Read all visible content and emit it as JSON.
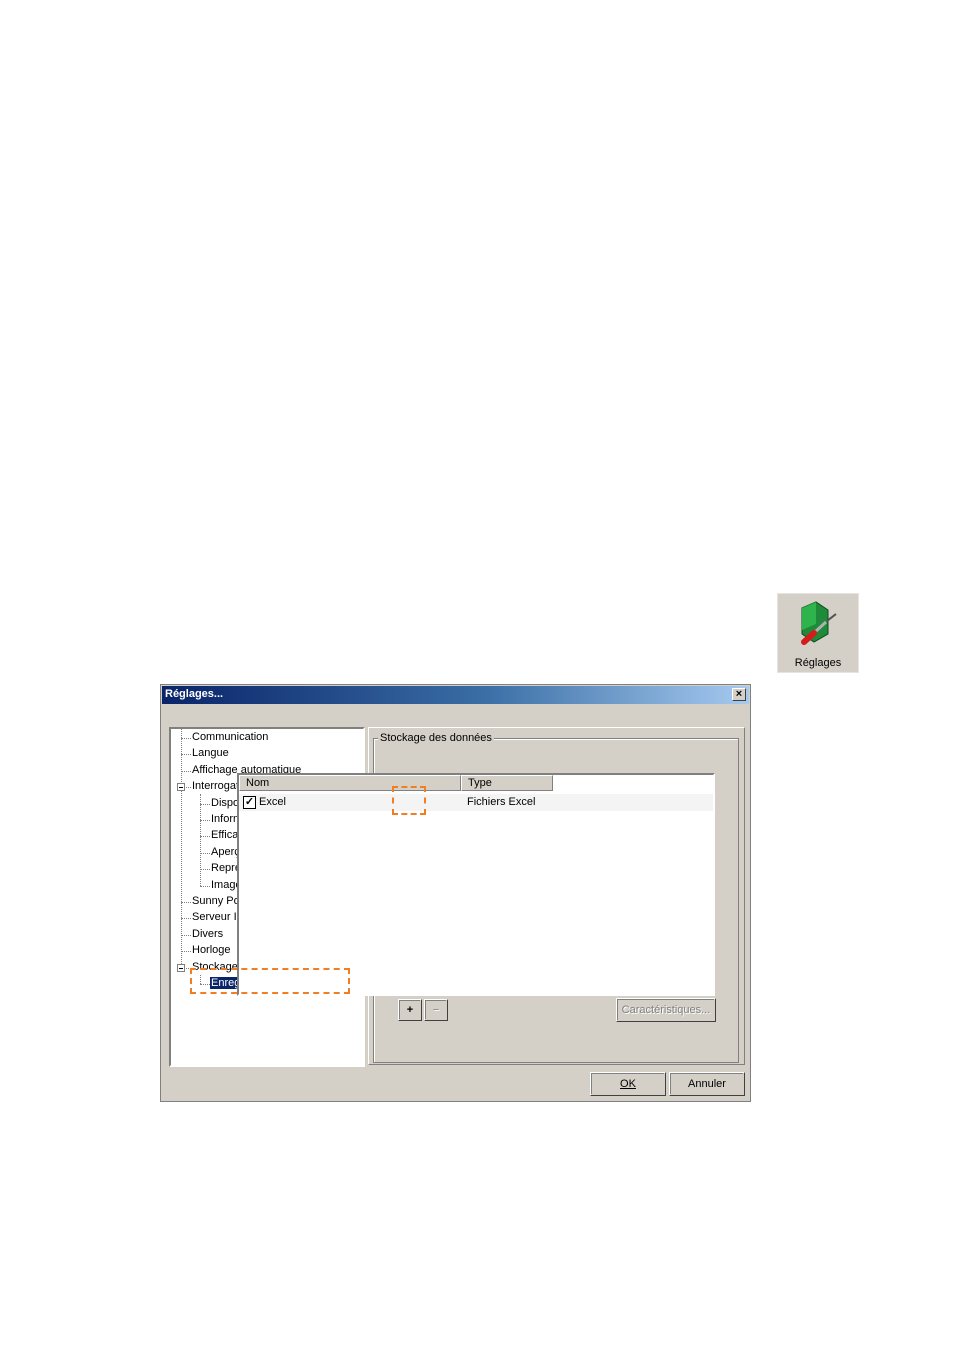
{
  "toolbar_icon": {
    "label": "Réglages",
    "icon": "settings-folder-screwdriver-icon"
  },
  "dialog": {
    "title": "Réglages...",
    "close_label": "×",
    "tree": [
      {
        "label": "Communication",
        "level": 0
      },
      {
        "label": "Langue",
        "level": 0
      },
      {
        "label": "Affichage automatique",
        "level": 0
      },
      {
        "label": "Interrogation valeur spot",
        "level": 0,
        "expanded": true
      },
      {
        "label": "Disposition",
        "level": 1
      },
      {
        "label": "Information rapide",
        "level": 1
      },
      {
        "label": "Efficacité de la communication",
        "level": 1
      },
      {
        "label": "Aperçu général",
        "level": 1
      },
      {
        "label": "Représentation en couleur",
        "level": 1
      },
      {
        "label": "Images de fond",
        "level": 1
      },
      {
        "label": "Sunny Portal Mail",
        "level": 0
      },
      {
        "label": "Serveur Internet",
        "level": 0
      },
      {
        "label": "Divers",
        "level": 0
      },
      {
        "label": "Horloge",
        "level": 0
      },
      {
        "label": "Stockage des données",
        "level": 0,
        "expanded": true
      },
      {
        "label": "Enregistreurs de données",
        "level": 1,
        "selected": true
      }
    ],
    "group_title": "Stockage des données",
    "list": {
      "columns": [
        "Nom",
        "Type"
      ],
      "rows": [
        {
          "checked": true,
          "name": "Excel",
          "type": "Fichiers Excel"
        }
      ]
    },
    "add_label": "+",
    "remove_label": "−",
    "properties_label": "Caractéristiques...",
    "ok_label": "OK",
    "cancel_label": "Annuler",
    "highlight_color": "#f07f23"
  }
}
